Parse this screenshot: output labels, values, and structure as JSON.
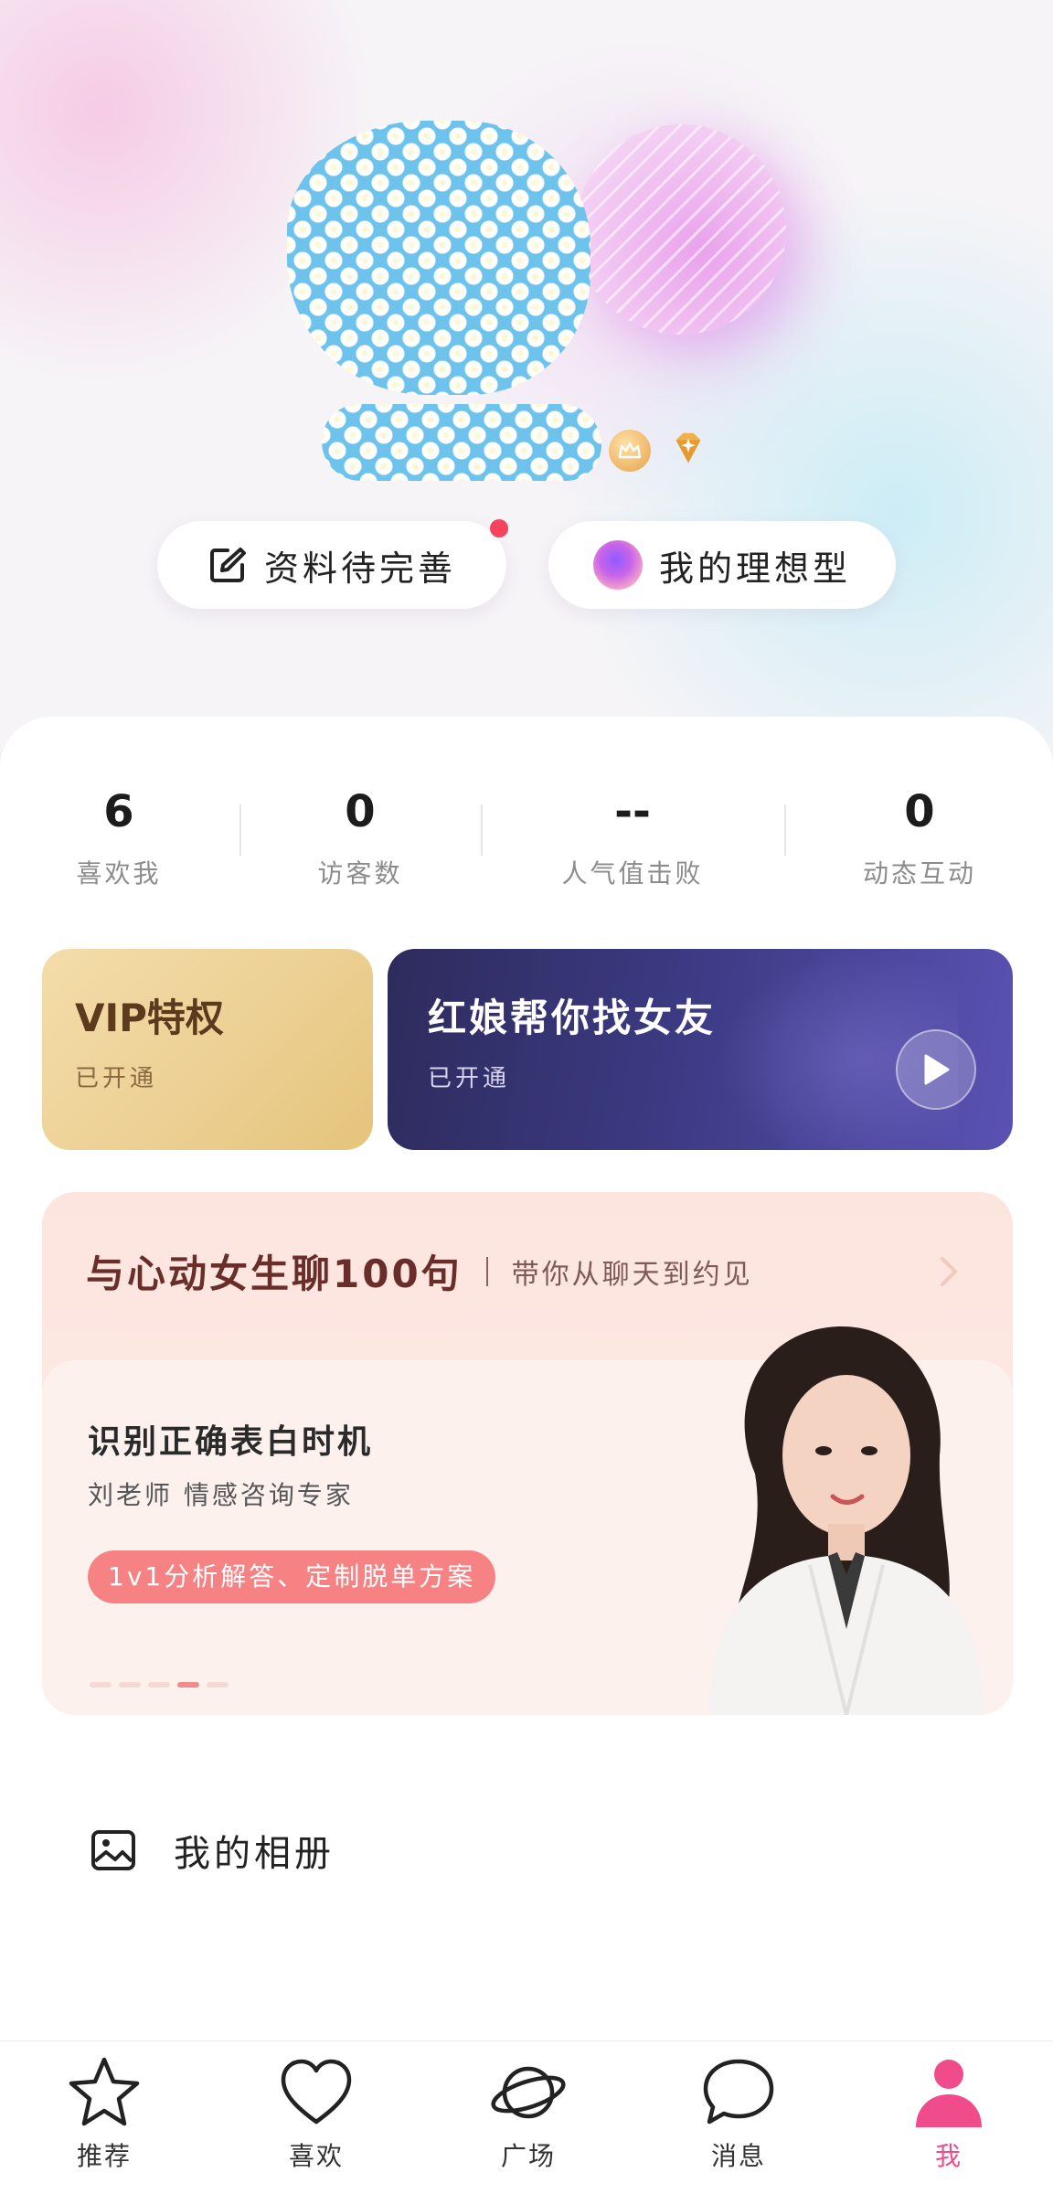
{
  "profile": {
    "complete_profile_label": "资料待完善",
    "ideal_type_label": "我的理想型"
  },
  "stats": [
    {
      "value": "6",
      "label": "喜欢我"
    },
    {
      "value": "0",
      "label": "访客数"
    },
    {
      "value": "--",
      "label": "人气值击败"
    },
    {
      "value": "0",
      "label": "动态互动"
    }
  ],
  "vip": {
    "title": "VIP特权",
    "status": "已开通"
  },
  "matchmaker": {
    "title": "红娘帮你找女友",
    "status": "已开通"
  },
  "promo": {
    "title": "与心动女生聊100句",
    "subtitle": "带你从聊天到约见",
    "topic": "识别正确表白时机",
    "expert": "刘老师 情感咨询专家",
    "tag": "1v1分析解答、定制脱单方案",
    "slide_count": 5,
    "active_slide": 4
  },
  "menu": {
    "album_label": "我的相册"
  },
  "nav": [
    {
      "label": "推荐",
      "icon": "star-icon"
    },
    {
      "label": "喜欢",
      "icon": "heart-icon"
    },
    {
      "label": "广场",
      "icon": "planet-icon"
    },
    {
      "label": "消息",
      "icon": "message-icon"
    },
    {
      "label": "我",
      "icon": "person-icon",
      "active": true
    }
  ],
  "colors": {
    "accent": "#f04b8a",
    "notification_dot": "#f4425f",
    "promo_tag": "#f68284"
  }
}
